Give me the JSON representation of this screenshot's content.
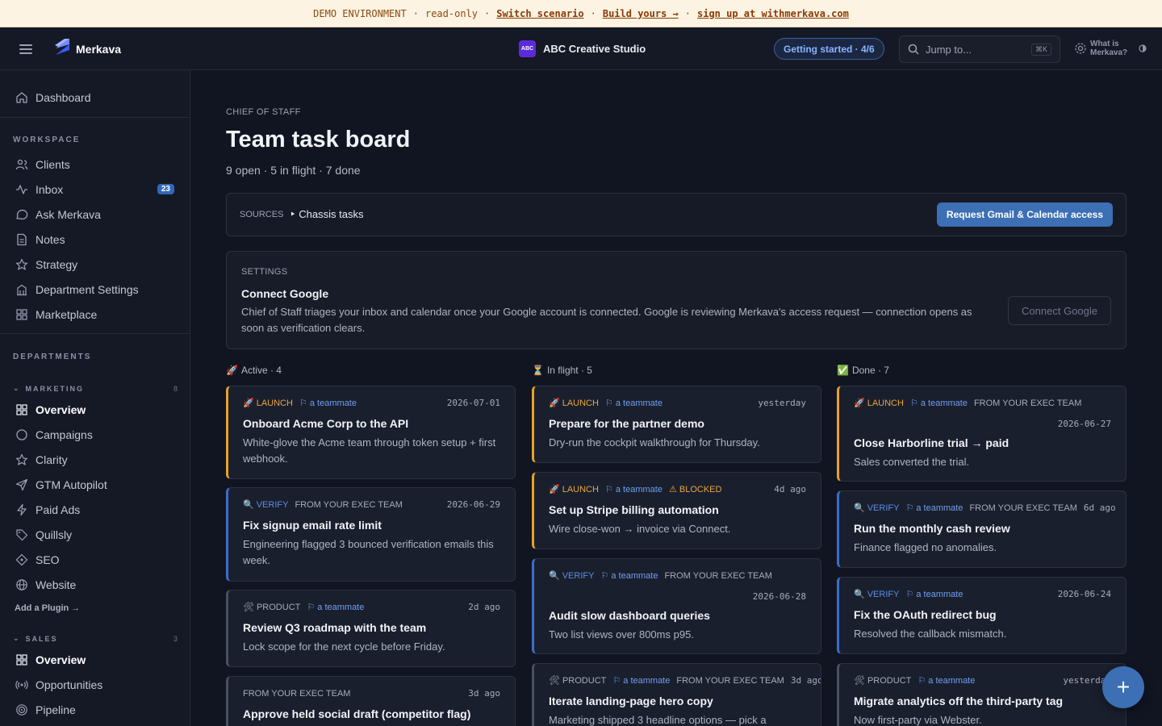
{
  "banner": {
    "env": "DEMO ENVIRONMENT",
    "mode": "read-only",
    "switch": "Switch scenario",
    "build": "Build yours →",
    "signup": "sign up at withmerkava.com",
    "sep": "·"
  },
  "topbar": {
    "logo": "Merkava",
    "org_badge": "ABC",
    "org_name": "ABC Creative Studio",
    "getting_started": "Getting started · 4/6",
    "jump_placeholder": "Jump to...",
    "jump_shortcut": "⌘K",
    "what_is": "What is Merkava?"
  },
  "sidebar": {
    "dashboard": "Dashboard",
    "workspace_label": "WORKSPACE",
    "workspace": [
      {
        "label": "Clients",
        "icon": "users-icon"
      },
      {
        "label": "Inbox",
        "icon": "activity-icon",
        "badge": "23"
      },
      {
        "label": "Ask Merkava",
        "icon": "chat-icon"
      },
      {
        "label": "Notes",
        "icon": "note-icon"
      },
      {
        "label": "Strategy",
        "icon": "star-icon"
      },
      {
        "label": "Department Settings",
        "icon": "building-icon"
      },
      {
        "label": "Marketplace",
        "icon": "grid-icon"
      }
    ],
    "departments_label": "DEPARTMENTS",
    "marketing": {
      "label": "MARKETING",
      "count": "8",
      "items": [
        {
          "label": "Overview",
          "icon": "grid-icon"
        },
        {
          "label": "Campaigns",
          "icon": "circle-icon"
        },
        {
          "label": "Clarity",
          "icon": "star-icon"
        },
        {
          "label": "GTM Autopilot",
          "icon": "send-icon"
        },
        {
          "label": "Paid Ads",
          "icon": "bolt-icon"
        },
        {
          "label": "Quillsly",
          "icon": "tag-icon"
        },
        {
          "label": "SEO",
          "icon": "diamond-icon"
        },
        {
          "label": "Website",
          "icon": "globe-icon"
        }
      ]
    },
    "add_plugin": "Add a Plugin →",
    "sales": {
      "label": "SALES",
      "count": "3",
      "items": [
        {
          "label": "Overview",
          "icon": "grid-icon"
        },
        {
          "label": "Opportunities",
          "icon": "broadcast-icon"
        },
        {
          "label": "Pipeline",
          "icon": "target-icon"
        }
      ]
    }
  },
  "main": {
    "eyebrow": "CHIEF OF STAFF",
    "title": "Team task board",
    "subtitle": "9 open · 5 in flight · 7 done",
    "sources_label": "SOURCES",
    "sources_value": "‣ Chassis tasks",
    "request_button": "Request Gmail & Calendar access",
    "settings_label": "SETTINGS",
    "settings_title": "Connect Google",
    "settings_desc": "Chief of Staff triages your inbox and calendar once your Google account is connected. Google is reviewing Merkava's access request — connection opens as soon as verification clears.",
    "connect_button": "Connect Google"
  },
  "columns": [
    {
      "emoji": "🚀",
      "label": "Active · 4",
      "cards": [
        {
          "kind": "launch",
          "tag": "LAUNCH",
          "emoji": "🚀",
          "assignee": "⚐ a teammate",
          "from": "",
          "blocked": "",
          "when": "2026-07-01",
          "title": "Onboard Acme Corp to the API",
          "desc": "White-glove the Acme team through token setup + first webhook."
        },
        {
          "kind": "verify",
          "tag": "VERIFY",
          "emoji": "🔍",
          "assignee": "",
          "from": "FROM YOUR EXEC TEAM",
          "blocked": "",
          "when": "2026-06-29",
          "title": "Fix signup email rate limit",
          "desc": "Engineering flagged 3 bounced verification emails this week."
        },
        {
          "kind": "product",
          "tag": "PRODUCT",
          "emoji": "🛠",
          "assignee": "⚐ a teammate",
          "from": "",
          "blocked": "",
          "when": "2d ago",
          "title": "Review Q3 roadmap with the team",
          "desc": "Lock scope for the next cycle before Friday."
        },
        {
          "kind": "none",
          "tag": "",
          "emoji": "",
          "assignee": "",
          "from": "FROM YOUR EXEC TEAM",
          "blocked": "",
          "when": "3d ago",
          "title": "Approve held social draft (competitor flag)",
          "desc": ""
        }
      ]
    },
    {
      "emoji": "⏳",
      "label": "In flight · 5",
      "cards": [
        {
          "kind": "launch",
          "tag": "LAUNCH",
          "emoji": "🚀",
          "assignee": "⚐ a teammate",
          "from": "",
          "blocked": "",
          "when": "yesterday",
          "title": "Prepare for the partner demo",
          "desc": "Dry-run the cockpit walkthrough for Thursday."
        },
        {
          "kind": "launch",
          "tag": "LAUNCH",
          "emoji": "🚀",
          "assignee": "⚐ a teammate",
          "from": "",
          "blocked": "⚠ BLOCKED",
          "when": "4d ago",
          "title": "Set up Stripe billing automation",
          "desc": "Wire close-won → invoice via Connect."
        },
        {
          "kind": "verify",
          "tag": "VERIFY",
          "emoji": "🔍",
          "assignee": "⚐ a teammate",
          "from": "FROM YOUR EXEC TEAM",
          "blocked": "",
          "when": "2026-06-28",
          "title": "Audit slow dashboard queries",
          "desc": "Two list views over 800ms p95."
        },
        {
          "kind": "product",
          "tag": "PRODUCT",
          "emoji": "🛠",
          "assignee": "⚐ a teammate",
          "from": "FROM YOUR EXEC TEAM",
          "blocked": "",
          "when": "3d ago",
          "title": "Iterate landing-page hero copy",
          "desc": "Marketing shipped 3 headline options — pick a"
        }
      ]
    },
    {
      "emoji": "✅",
      "label": "Done · 7",
      "cards": [
        {
          "kind": "launch",
          "tag": "LAUNCH",
          "emoji": "🚀",
          "assignee": "⚐ a teammate",
          "from": "FROM YOUR EXEC TEAM",
          "blocked": "",
          "when": "2026-06-27",
          "title": "Close Harborline trial → paid",
          "desc": "Sales converted the trial."
        },
        {
          "kind": "verify",
          "tag": "VERIFY",
          "emoji": "🔍",
          "assignee": "⚐ a teammate",
          "from": "FROM YOUR EXEC TEAM",
          "blocked": "",
          "when": "6d ago",
          "title": "Run the monthly cash review",
          "desc": "Finance flagged no anomalies."
        },
        {
          "kind": "verify",
          "tag": "VERIFY",
          "emoji": "🔍",
          "assignee": "⚐ a teammate",
          "from": "",
          "blocked": "",
          "when": "2026-06-24",
          "title": "Fix the OAuth redirect bug",
          "desc": "Resolved the callback mismatch."
        },
        {
          "kind": "product",
          "tag": "PRODUCT",
          "emoji": "🛠",
          "assignee": "⚐ a teammate",
          "from": "",
          "blocked": "",
          "when": "yesterday",
          "title": "Migrate analytics off the third-party tag",
          "desc": "Now first-party via Webster."
        }
      ]
    }
  ],
  "fab": "+"
}
